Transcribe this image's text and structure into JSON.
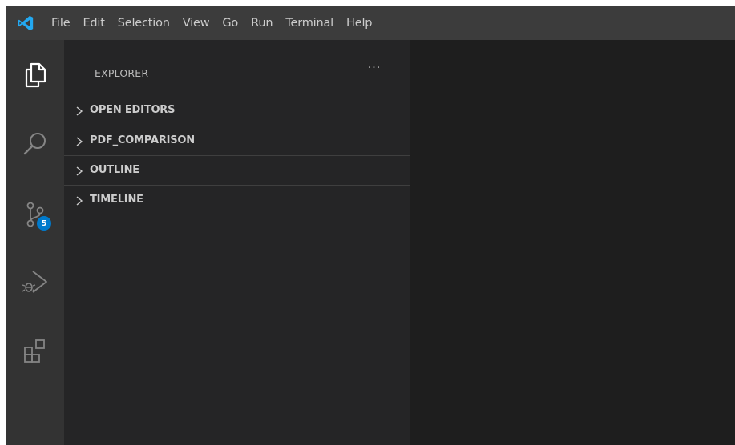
{
  "menu": {
    "items": [
      "File",
      "Edit",
      "Selection",
      "View",
      "Go",
      "Run",
      "Terminal",
      "Help"
    ]
  },
  "activity_bar": {
    "icons": [
      "explorer-icon",
      "search-icon",
      "source-control-icon",
      "run-debug-icon",
      "extensions-icon"
    ],
    "source_control_badge": "5"
  },
  "sidebar": {
    "title": "EXPLORER",
    "more_actions": "···",
    "sections": [
      {
        "label": "OPEN EDITORS"
      },
      {
        "label": "PDF_COMPARISON"
      },
      {
        "label": "OUTLINE"
      },
      {
        "label": "TIMELINE"
      }
    ]
  },
  "colors": {
    "titlebar": "#3c3c3c",
    "activitybar": "#333333",
    "sidebar": "#252526",
    "editor": "#1e1e1e",
    "accent": "#007acc",
    "logo": "#23a9f2"
  }
}
